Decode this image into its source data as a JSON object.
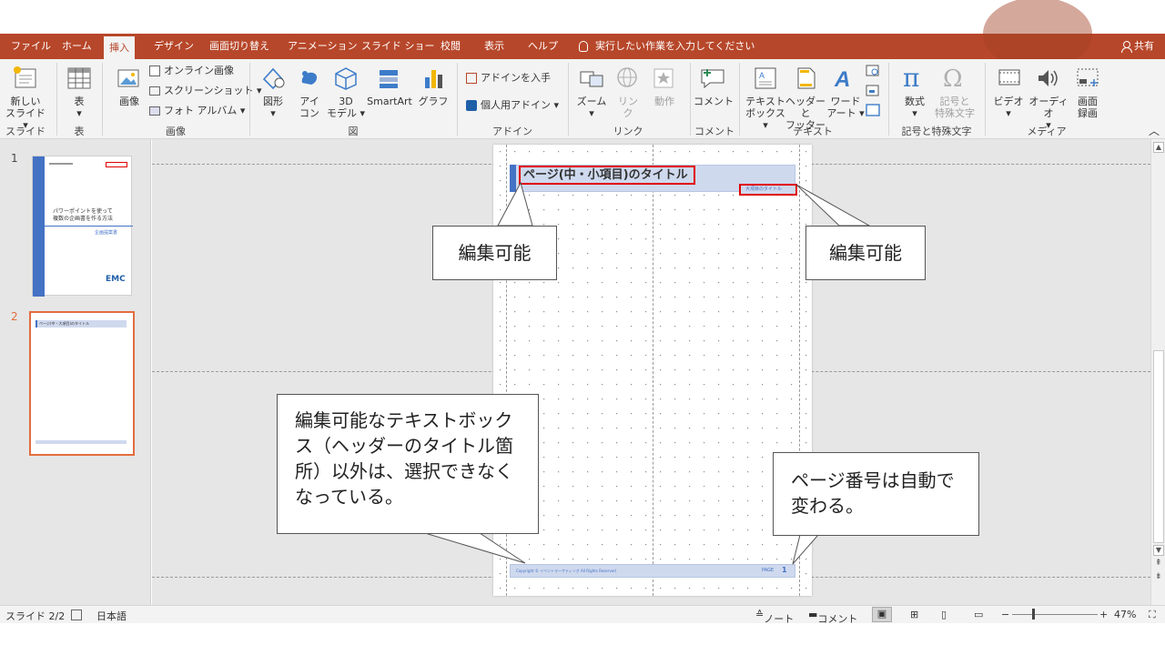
{
  "colors": {
    "accent": "#b7472a",
    "header_band": "#cfd9ee",
    "header_blue": "#4472c4",
    "highlight_red": "#e00000",
    "selection_orange": "#e26c3f"
  },
  "tabs": [
    "ファイル",
    "ホーム",
    "挿入",
    "デザイン",
    "画面切り替え",
    "アニメーション",
    "スライド ショー",
    "校閲",
    "表示",
    "ヘルプ"
  ],
  "active_tab": "挿入",
  "tell_me": "実行したい作業を入力してください",
  "share": "共有",
  "ribbon": {
    "new_slide": "新しい\nスライド ▾",
    "table": "表",
    "image": "画像",
    "online_image": "オンライン画像",
    "screenshot": "スクリーンショット ▾",
    "photo_album": "フォト アルバム ▾",
    "shapes": "図形",
    "icons": "アイ\nコン",
    "model3d": "3D\nモデル ▾",
    "smartart": "SmartArt",
    "chart": "グラフ",
    "get_addins": "アドインを入手",
    "my_addins": "個人用アドイン ▾",
    "zoom": "ズーム",
    "link": "リン\nク",
    "action": "動作",
    "comment": "コメント",
    "textbox": "テキスト\nボックス ▾",
    "header_footer": "ヘッダーと\nフッター",
    "wordart": "ワード\nアート ▾",
    "equation": "数式",
    "symbol": "記号と\n特殊文字",
    "video": "ビデオ",
    "audio": "オーディオ",
    "screen_rec": "画面\n録画",
    "groups": {
      "slide": "スライド",
      "table": "表",
      "images": "画像",
      "illustrations": "図",
      "addins": "アドイン",
      "links": "リンク",
      "comments": "コメント",
      "text": "テキスト",
      "symbols": "記号と特殊文字",
      "media": "メディア"
    }
  },
  "thumbnails": [
    {
      "number": "1",
      "title_line1": "パワーポイントを使って",
      "title_line2": "複数の企画書を作る方法",
      "subtitle": "企画提案書",
      "logo": "EMC"
    },
    {
      "number": "2",
      "header": "ページ(中・大項目)のタイトル"
    }
  ],
  "slide": {
    "title": "ページ(中・小項目)のタイトル",
    "header_right": "大項目のタイトル",
    "footer_copy": "Copyright © イベントマーケティング All Rights Reserved",
    "page_label": "PAGE",
    "page_number": "1"
  },
  "callouts": {
    "editable_left": "編集可能",
    "editable_right": "編集可能",
    "not_selectable": "編集可能なテキストボックス（ヘッダーのタイトル箇所）以外は、選択できなくなっている。",
    "page_auto": "ページ番号は自動で変わる。"
  },
  "status": {
    "slide_count": "スライド 2/2",
    "language": "日本語",
    "notes": "ノート",
    "comments": "コメント",
    "zoom": "47%",
    "zoom_level": 0.47
  }
}
